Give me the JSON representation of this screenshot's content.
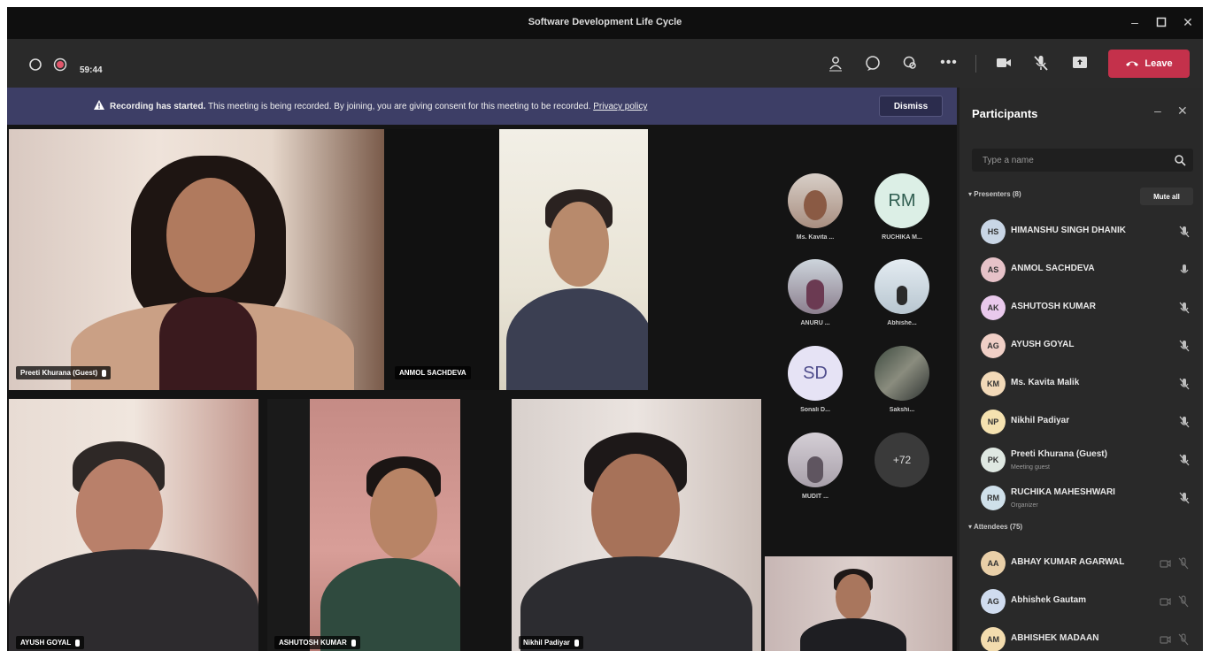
{
  "window": {
    "title": "Software Development Life Cycle"
  },
  "toolbar": {
    "timer": "59:44",
    "leave_label": "Leave"
  },
  "banner": {
    "bold_text": "Recording has started.",
    "text": "This meeting is being recorded. By joining, you are giving consent for this meeting to be recorded.",
    "link_text": "Privacy policy",
    "dismiss_label": "Dismiss"
  },
  "videos": [
    {
      "name": "Preeti Khurana (Guest)"
    },
    {
      "name": "ANMOL SACHDEVA"
    },
    {
      "name": "AYUSH GOYAL"
    },
    {
      "name": "ASHUTOSH KUMAR"
    },
    {
      "name": "Nikhil Padiyar"
    }
  ],
  "gallery": [
    {
      "label": "Ms. Kavita ...",
      "initials": ""
    },
    {
      "label": "RUCHIKA M...",
      "initials": "RM"
    },
    {
      "label": "ANURU ...",
      "initials": ""
    },
    {
      "label": "Abhishe...",
      "initials": ""
    },
    {
      "label": "Sonali D...",
      "initials": "SD"
    },
    {
      "label": "Sakshi...",
      "initials": ""
    },
    {
      "label": "MUDIT ...",
      "initials": ""
    },
    {
      "label": "",
      "initials": "+72"
    }
  ],
  "participants_panel": {
    "title": "Participants",
    "search_placeholder": "Type a name",
    "presenters_label": "Presenters (8)",
    "mute_all_label": "Mute all",
    "attendees_label": "Attendees (75)",
    "presenters": [
      {
        "name": "HIMANSHU SINGH DHANIK",
        "sub": "",
        "initials": "HS"
      },
      {
        "name": "ANMOL SACHDEVA",
        "sub": "",
        "initials": "AS"
      },
      {
        "name": "ASHUTOSH KUMAR",
        "sub": "",
        "initials": "AK"
      },
      {
        "name": "AYUSH GOYAL",
        "sub": "",
        "initials": "AG"
      },
      {
        "name": "Ms. Kavita Malik",
        "sub": "",
        "initials": "KM"
      },
      {
        "name": "Nikhil Padiyar",
        "sub": "",
        "initials": "NP"
      },
      {
        "name": "Preeti Khurana (Guest)",
        "sub": "Meeting guest",
        "initials": "PK"
      },
      {
        "name": "RUCHIKA MAHESHWARI",
        "sub": "Organizer",
        "initials": "RM"
      }
    ],
    "attendees": [
      {
        "name": "ABHAY KUMAR AGARWAL",
        "initials": "AA"
      },
      {
        "name": "Abhishek Gautam",
        "initials": "AG"
      },
      {
        "name": "ABHISHEK MADAAN",
        "initials": "AM"
      }
    ]
  }
}
